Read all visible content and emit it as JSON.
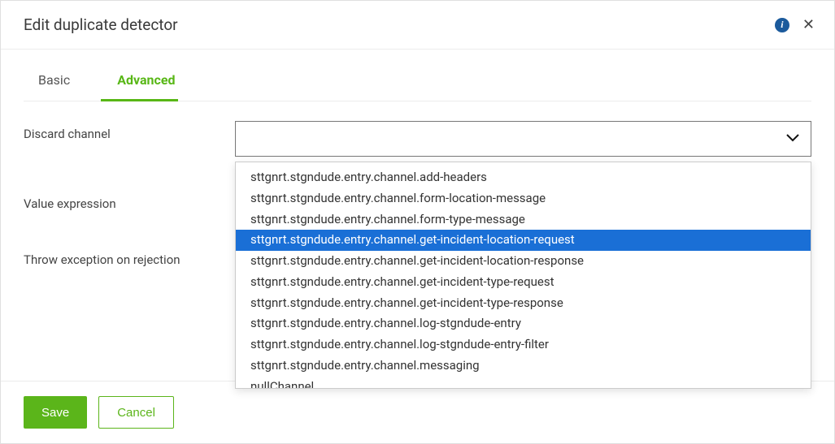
{
  "header": {
    "title": "Edit duplicate detector"
  },
  "tabs": {
    "basic": "Basic",
    "advanced": "Advanced"
  },
  "form": {
    "discard_channel_label": "Discard channel",
    "discard_channel_value": "",
    "value_expression_label": "Value expression",
    "throw_exception_label": "Throw exception on rejection"
  },
  "dropdown": {
    "options": [
      "sttgnrt.stgndude.entry.channel.add-headers",
      "sttgnrt.stgndude.entry.channel.form-location-message",
      "sttgnrt.stgndude.entry.channel.form-type-message",
      "sttgnrt.stgndude.entry.channel.get-incident-location-request",
      "sttgnrt.stgndude.entry.channel.get-incident-location-response",
      "sttgnrt.stgndude.entry.channel.get-incident-type-request",
      "sttgnrt.stgndude.entry.channel.get-incident-type-response",
      "sttgnrt.stgndude.entry.channel.log-stgndude-entry",
      "sttgnrt.stgndude.entry.channel.log-stgndude-entry-filter",
      "sttgnrt.stgndude.entry.channel.messaging",
      "nullChannel"
    ],
    "highlighted_index": 3
  },
  "footer": {
    "save": "Save",
    "cancel": "Cancel"
  }
}
